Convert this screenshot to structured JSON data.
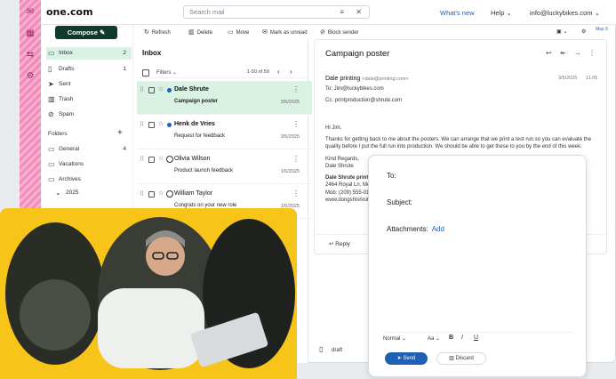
{
  "brand": "one.com",
  "header": {
    "search_placeholder": "Search mail",
    "whats_new": "What's new",
    "help": "Help",
    "account": "info@luckybikes.com"
  },
  "sidebar": {
    "compose": "Compose",
    "folders_title": "Folders",
    "items": [
      {
        "label": "Inbox",
        "count": "2",
        "icon": "inbox-icon"
      },
      {
        "label": "Drafts",
        "count": "1",
        "icon": "file-icon"
      },
      {
        "label": "Sent",
        "count": "",
        "icon": "send-icon"
      },
      {
        "label": "Trash",
        "count": "",
        "icon": "trash-icon"
      },
      {
        "label": "Spam",
        "count": "",
        "icon": "spam-icon"
      }
    ],
    "folders": [
      {
        "label": "General",
        "count": "4"
      },
      {
        "label": "Vacations",
        "count": ""
      },
      {
        "label": "Archives",
        "count": ""
      },
      {
        "label": "2025",
        "count": ""
      }
    ]
  },
  "toolbar": {
    "refresh": "Refresh",
    "delete": "Delete",
    "move": "Move",
    "mark_unread": "Mark as unread",
    "block": "Block sender",
    "date_badge": "May 3"
  },
  "list": {
    "title": "Inbox",
    "filters": "Filters",
    "range": "1-50 of 59",
    "rows": [
      {
        "name": "Dale Shrute",
        "subject": "Campaign poster",
        "date": "3/5/2025"
      },
      {
        "name": "Henk de Vries",
        "subject": "Request for feedback",
        "date": "3/5/2025"
      },
      {
        "name": "Olivia Wilson",
        "subject": "Product launch feedback",
        "date": "1/5/2025"
      },
      {
        "name": "William Taylor",
        "subject": "Congrats on your new role",
        "date": "1/5/2025"
      }
    ]
  },
  "reader": {
    "subject": "Campaign poster",
    "from_name": "Dale printing",
    "from_email": "<dale@printing.com>",
    "date": "3/5/2025",
    "time": "11:05",
    "to": "To: Jim@luckybikes.com",
    "cc": "Cc: printproduction@shrute.com",
    "greeting": "Hi Jim,",
    "body": "Thanks for getting back to me about the posters. We can arrange that we print a test run so you can evaluate the quality before I put the full run into production. We should be able to get these to you by the end of this week.",
    "regards": "Kind Regards,",
    "sign": "Dale Shrute",
    "sig_company": "Dale Shrute printing",
    "sig_addr": "2464 Royal Ln. Mesa",
    "sig_mob": "Mob: (209) 555-0104",
    "sig_web": "www.dongshishrute.com",
    "reply": "Reply"
  },
  "draft": {
    "label": "draft"
  },
  "composer": {
    "to": "To:",
    "subject": "Subject:",
    "attachments": "Attachments:",
    "add": "Add",
    "normal": "Normal",
    "size": "Aa",
    "bold": "B",
    "italic": "I",
    "underline": "U",
    "send": "Send",
    "discard": "Discard"
  },
  "colors": {
    "accent": "#0e3b2e",
    "selected": "#d9f2e4",
    "link": "#1f5fb4",
    "photo_bg": "#f7c51a",
    "rail": "#f28ab9"
  }
}
